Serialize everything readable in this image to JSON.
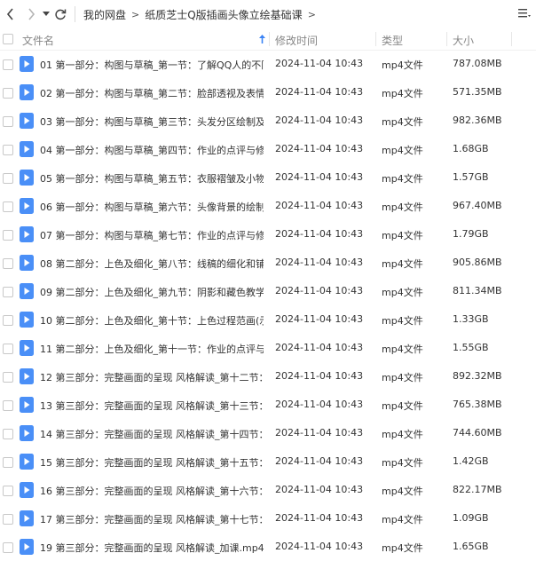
{
  "breadcrumb": [
    "我的网盘",
    "纸质芝士Q版插画头像立绘基础课"
  ],
  "columns": {
    "name": "文件名",
    "modified": "修改时间",
    "type": "类型",
    "size": "大小"
  },
  "colors": {
    "icon_blue": "#4a8ff7",
    "sort_arrow": "#3b84f5"
  },
  "files": [
    {
      "name": "01 第一部分：构图与草稿_第一节：了解QQ人的不同头...",
      "modified": "2024-11-04 10:43",
      "type": "mp4文件",
      "size": "787.08MB"
    },
    {
      "name": "02 第一部分：构图与草稿_第二节：脸部透视及表情绘制....",
      "modified": "2024-11-04 10:43",
      "type": "mp4文件",
      "size": "571.35MB"
    },
    {
      "name": "03 第一部分：构图与草稿_第三节：头发分区绘制及手的...",
      "modified": "2024-11-04 10:43",
      "type": "mp4文件",
      "size": "982.36MB"
    },
    {
      "name": "04 第一部分：构图与草稿_第四节：作业的点评与修改.m...",
      "modified": "2024-11-04 10:43",
      "type": "mp4文件",
      "size": "1.68GB"
    },
    {
      "name": "05 第一部分：构图与草稿_第五节：衣服褶皱及小物的绘...",
      "modified": "2024-11-04 10:43",
      "type": "mp4文件",
      "size": "1.57GB"
    },
    {
      "name": "06 第一部分：构图与草稿_第六节：头像背景的绘制及构...",
      "modified": "2024-11-04 10:43",
      "type": "mp4文件",
      "size": "967.40MB"
    },
    {
      "name": "07 第一部分：构图与草稿_第七节：作业的点评与修改.m...",
      "modified": "2024-11-04 10:43",
      "type": "mp4文件",
      "size": "1.79GB"
    },
    {
      "name": "08 第二部分：上色及细化_第八节：线稿的细化和铺色.m...",
      "modified": "2024-11-04 10:43",
      "type": "mp4文件",
      "size": "905.86MB"
    },
    {
      "name": "09 第二部分：上色及细化_第九节：阴影和藏色教学.mp4",
      "modified": "2024-11-04 10:43",
      "type": "mp4文件",
      "size": "811.34MB"
    },
    {
      "name": "10 第二部分：上色及细化_第十节：上色过程范画(示范...",
      "modified": "2024-11-04 10:43",
      "type": "mp4文件",
      "size": "1.33GB"
    },
    {
      "name": "11 第二部分：上色及细化_第十一节：作业的点评与修改....",
      "modified": "2024-11-04 10:43",
      "type": "mp4文件",
      "size": "1.55GB"
    },
    {
      "name": "12 第三部分：完整画面的呈现 风格解读_第十二节：Q版...",
      "modified": "2024-11-04 10:43",
      "type": "mp4文件",
      "size": "892.32MB"
    },
    {
      "name": "13 第三部分：完整画面的呈现 风格解读_第十三节：蹲坐...",
      "modified": "2024-11-04 10:43",
      "type": "mp4文件",
      "size": "765.38MB"
    },
    {
      "name": "14 第三部分：完整画面的呈现 风格解读_第十四节：双人...",
      "modified": "2024-11-04 10:43",
      "type": "mp4文件",
      "size": "744.60MB"
    },
    {
      "name": "15 第三部分：完整画面的呈现 风格解读_第十五节：作业...",
      "modified": "2024-11-04 10:43",
      "type": "mp4文件",
      "size": "1.42GB"
    },
    {
      "name": "16 第三部分：完整画面的呈现 风格解读_第十六节：伪厚...",
      "modified": "2024-11-04 10:43",
      "type": "mp4文件",
      "size": "822.17MB"
    },
    {
      "name": "17 第三部分：完整画面的呈现 风格解读_第十七节：全身...",
      "modified": "2024-11-04 10:43",
      "type": "mp4文件",
      "size": "1.09GB"
    },
    {
      "name": "19 第三部分：完整画面的呈现 风格解读_加课.mp4",
      "modified": "2024-11-04 10:43",
      "type": "mp4文件",
      "size": "1.65GB"
    }
  ]
}
